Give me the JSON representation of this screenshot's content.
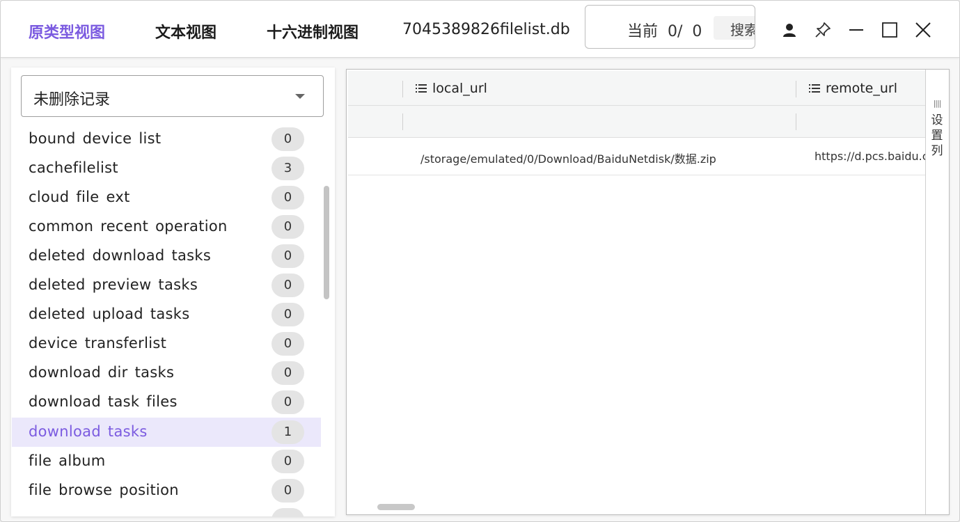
{
  "header": {
    "tabs": [
      {
        "label": "原类型视图",
        "active": true
      },
      {
        "label": "文本视图",
        "active": false
      },
      {
        "label": "十六进制视图",
        "active": false
      }
    ],
    "filename": "7045389826filelist.db",
    "search": {
      "current_label": "当前  0/  0",
      "button_label": "搜索"
    },
    "window_icons": [
      "user-icon",
      "pin-icon",
      "minimize-icon",
      "maximize-icon",
      "close-icon"
    ]
  },
  "sidebar": {
    "filter_select": {
      "value": "未删除记录"
    },
    "items": [
      {
        "label": "bound device list",
        "count": "0"
      },
      {
        "label": "cachefilelist",
        "count": "3"
      },
      {
        "label": "cloud file ext",
        "count": "0"
      },
      {
        "label": "common recent operation",
        "count": "0"
      },
      {
        "label": "deleted download tasks",
        "count": "0"
      },
      {
        "label": "deleted preview tasks",
        "count": "0"
      },
      {
        "label": "deleted upload tasks",
        "count": "0"
      },
      {
        "label": "device transferlist",
        "count": "0"
      },
      {
        "label": "download dir tasks",
        "count": "0"
      },
      {
        "label": "download task files",
        "count": "0"
      },
      {
        "label": "download tasks",
        "count": "1",
        "selected": true
      },
      {
        "label": "file album",
        "count": "0"
      },
      {
        "label": "file browse position",
        "count": "0"
      }
    ]
  },
  "grid": {
    "columns": [
      {
        "label": "local_url"
      },
      {
        "label": "remote_url"
      }
    ],
    "rows": [
      {
        "local_url": "/storage/emulated/0/Download/BaiduNetdisk/数据.zip",
        "remote_url": "https://d.pcs.baidu.com"
      }
    ],
    "settings_label": "设置列"
  },
  "colors": {
    "accent": "#7b5be0",
    "selected_bg": "#ebe8fb",
    "badge_bg": "#e4e4e4"
  }
}
